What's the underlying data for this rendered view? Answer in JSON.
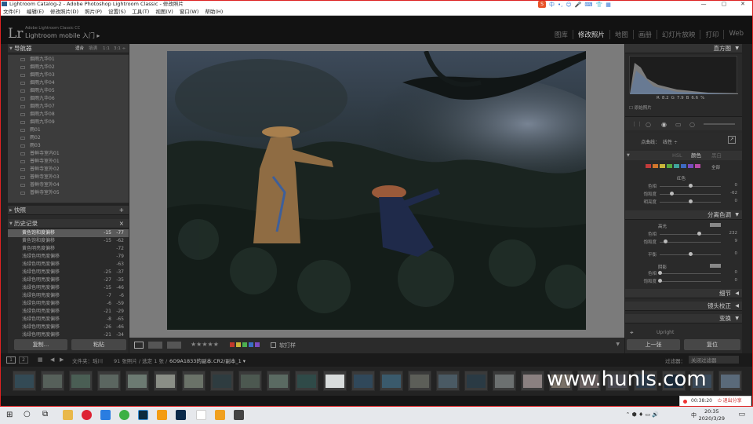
{
  "window": {
    "title": "Lightroom Catalog-2 - Adobe Photoshop Lightroom Classic - 修改照片",
    "controls": [
      "—",
      "▢",
      "✕"
    ]
  },
  "ime": {
    "items": [
      "中",
      "•,",
      "☺",
      "🎤",
      "⌨",
      "👕",
      "▦"
    ]
  },
  "menu": [
    "文件(F)",
    "编辑(E)",
    "修改照片(D)",
    "照片(P)",
    "设置(S)",
    "工具(T)",
    "视图(V)",
    "窗口(W)",
    "帮助(H)"
  ],
  "identity": {
    "logo": "Lr",
    "line1": "Adobe Lightroom Classic CC",
    "line2": "Lightroom mobile 入门 ▸",
    "modules": [
      {
        "label": "图库",
        "active": false
      },
      {
        "label": "修改照片",
        "active": true
      },
      {
        "label": "地图",
        "active": false
      },
      {
        "label": "画册",
        "active": false
      },
      {
        "label": "幻灯片放映",
        "active": false
      },
      {
        "label": "打印",
        "active": false
      },
      {
        "label": "Web",
        "active": false
      }
    ]
  },
  "left": {
    "navigator": {
      "title": "导航器",
      "zoom": [
        "适合",
        "填满",
        "1:1",
        "3:1 ÷"
      ]
    },
    "presets": [
      "烟雨九华01",
      "烟雨九华02",
      "烟雨九华03",
      "烟雨九华04",
      "烟雨九华05",
      "烟雨九华06",
      "烟雨九华07",
      "烟雨九华08",
      "烟雨九华09",
      "雨01",
      "雨02",
      "雨03",
      "普鲜寺室内01",
      "普鲜寺室外01",
      "普鲜寺室外02",
      "普鲜寺室外03",
      "普鲜寺室外04",
      "普鲜寺室外05"
    ],
    "snapshots": {
      "title": "快照",
      "add": "+"
    },
    "history": {
      "title": "历史记录",
      "close": "×",
      "rows": [
        {
          "label": "黄色饱和度偏移",
          "v1": "-15",
          "v2": "-77",
          "selected": true
        },
        {
          "label": "黄色饱和度偏移",
          "v1": "-15",
          "v2": "-62",
          "selected": false
        },
        {
          "label": "黄色明亮度偏移",
          "v1": "",
          "v2": "-72",
          "selected": false
        },
        {
          "label": "浅绿色明亮度偏移",
          "v1": "",
          "v2": "-79",
          "selected": false
        },
        {
          "label": "浅绿色明亮度偏移",
          "v1": "",
          "v2": "-63",
          "selected": false
        },
        {
          "label": "浅绿色明亮度偏移",
          "v1": "-25",
          "v2": "-37",
          "selected": false
        },
        {
          "label": "浅绿色明亮度偏移",
          "v1": "-27",
          "v2": "-35",
          "selected": false
        },
        {
          "label": "浅绿色明亮度偏移",
          "v1": "-15",
          "v2": "-46",
          "selected": false
        },
        {
          "label": "浅绿色明亮度偏移",
          "v1": "-7",
          "v2": "-6",
          "selected": false
        },
        {
          "label": "浅绿色明亮度偏移",
          "v1": "-6",
          "v2": "-59",
          "selected": false
        },
        {
          "label": "浅绿色明亮度偏移",
          "v1": "-21",
          "v2": "-29",
          "selected": false
        },
        {
          "label": "浅绿色明亮度偏移",
          "v1": "-8",
          "v2": "-65",
          "selected": false
        },
        {
          "label": "浅绿色明亮度偏移",
          "v1": "-26",
          "v2": "-46",
          "selected": false
        },
        {
          "label": "浅绿色明亮度偏移",
          "v1": "-21",
          "v2": "-34",
          "selected": false
        }
      ]
    },
    "copy_btn": "复制...",
    "paste_btn": "粘贴"
  },
  "right": {
    "histogram": {
      "title": "直方图",
      "readout": [
        "R",
        "8.2",
        "G",
        "7.9",
        "B",
        "6.6",
        "%"
      ],
      "original": "原始照片"
    },
    "curve": {
      "channel_label": "点曲线：",
      "channel_value": "线性 ÷"
    },
    "hsl": {
      "tabs": [
        "HSL",
        "颜色",
        "黑白"
      ],
      "swatches": [
        "#c23b3b",
        "#d0762c",
        "#c9b53a",
        "#56a83f",
        "#3fa39b",
        "#3d6ac2",
        "#7b4bc0",
        "#b94aa6"
      ],
      "all_label": "全部",
      "subtitle": "红色",
      "sliders": [
        {
          "label": "色相",
          "value": "0",
          "pos": 0.5
        },
        {
          "label": "饱和度",
          "value": "-62",
          "pos": 0.19
        },
        {
          "label": "明亮度",
          "value": "0",
          "pos": 0.5
        }
      ]
    },
    "split": {
      "title": "分离色调",
      "highlights": "高光",
      "hl_sliders": [
        {
          "label": "色相",
          "value": "232",
          "pos": 0.64
        },
        {
          "label": "饱和度",
          "value": "9",
          "pos": 0.09
        }
      ],
      "balance": {
        "label": "平衡",
        "value": "0",
        "pos": 0.5
      },
      "shadows": "阴影",
      "sh_sliders": [
        {
          "label": "色相",
          "value": "0",
          "pos": 0.0
        },
        {
          "label": "饱和度",
          "value": "0",
          "pos": 0.0
        }
      ]
    },
    "detail": "细节",
    "lens": "镜头校正",
    "transform": "变换",
    "upright": "Upright",
    "prev_btn": "上一张",
    "reset_btn": "复位"
  },
  "toolbar": {
    "stars": "★★★★★",
    "flag_colors": [
      "#c0392b",
      "#c9b53a",
      "#4caf50",
      "#3a6fc4",
      "#7b4bc0"
    ],
    "softproof": "软打样"
  },
  "filmbar": {
    "pages": [
      "1",
      "2"
    ],
    "path": "文件夹：瑶川",
    "count": "91 张照片 / 选定 1 张 /",
    "filename": "6O9A1833的副本.CR2/副本_1 ▾",
    "filter_label": "过滤器：",
    "filter_value": "关闭过滤器"
  },
  "watermark": "www.hunls.com",
  "recording": {
    "time": "00:38:20",
    "share": "退出分享"
  },
  "taskbar": {
    "time": "20:35",
    "date": "2020/3/29",
    "lang": "中"
  }
}
